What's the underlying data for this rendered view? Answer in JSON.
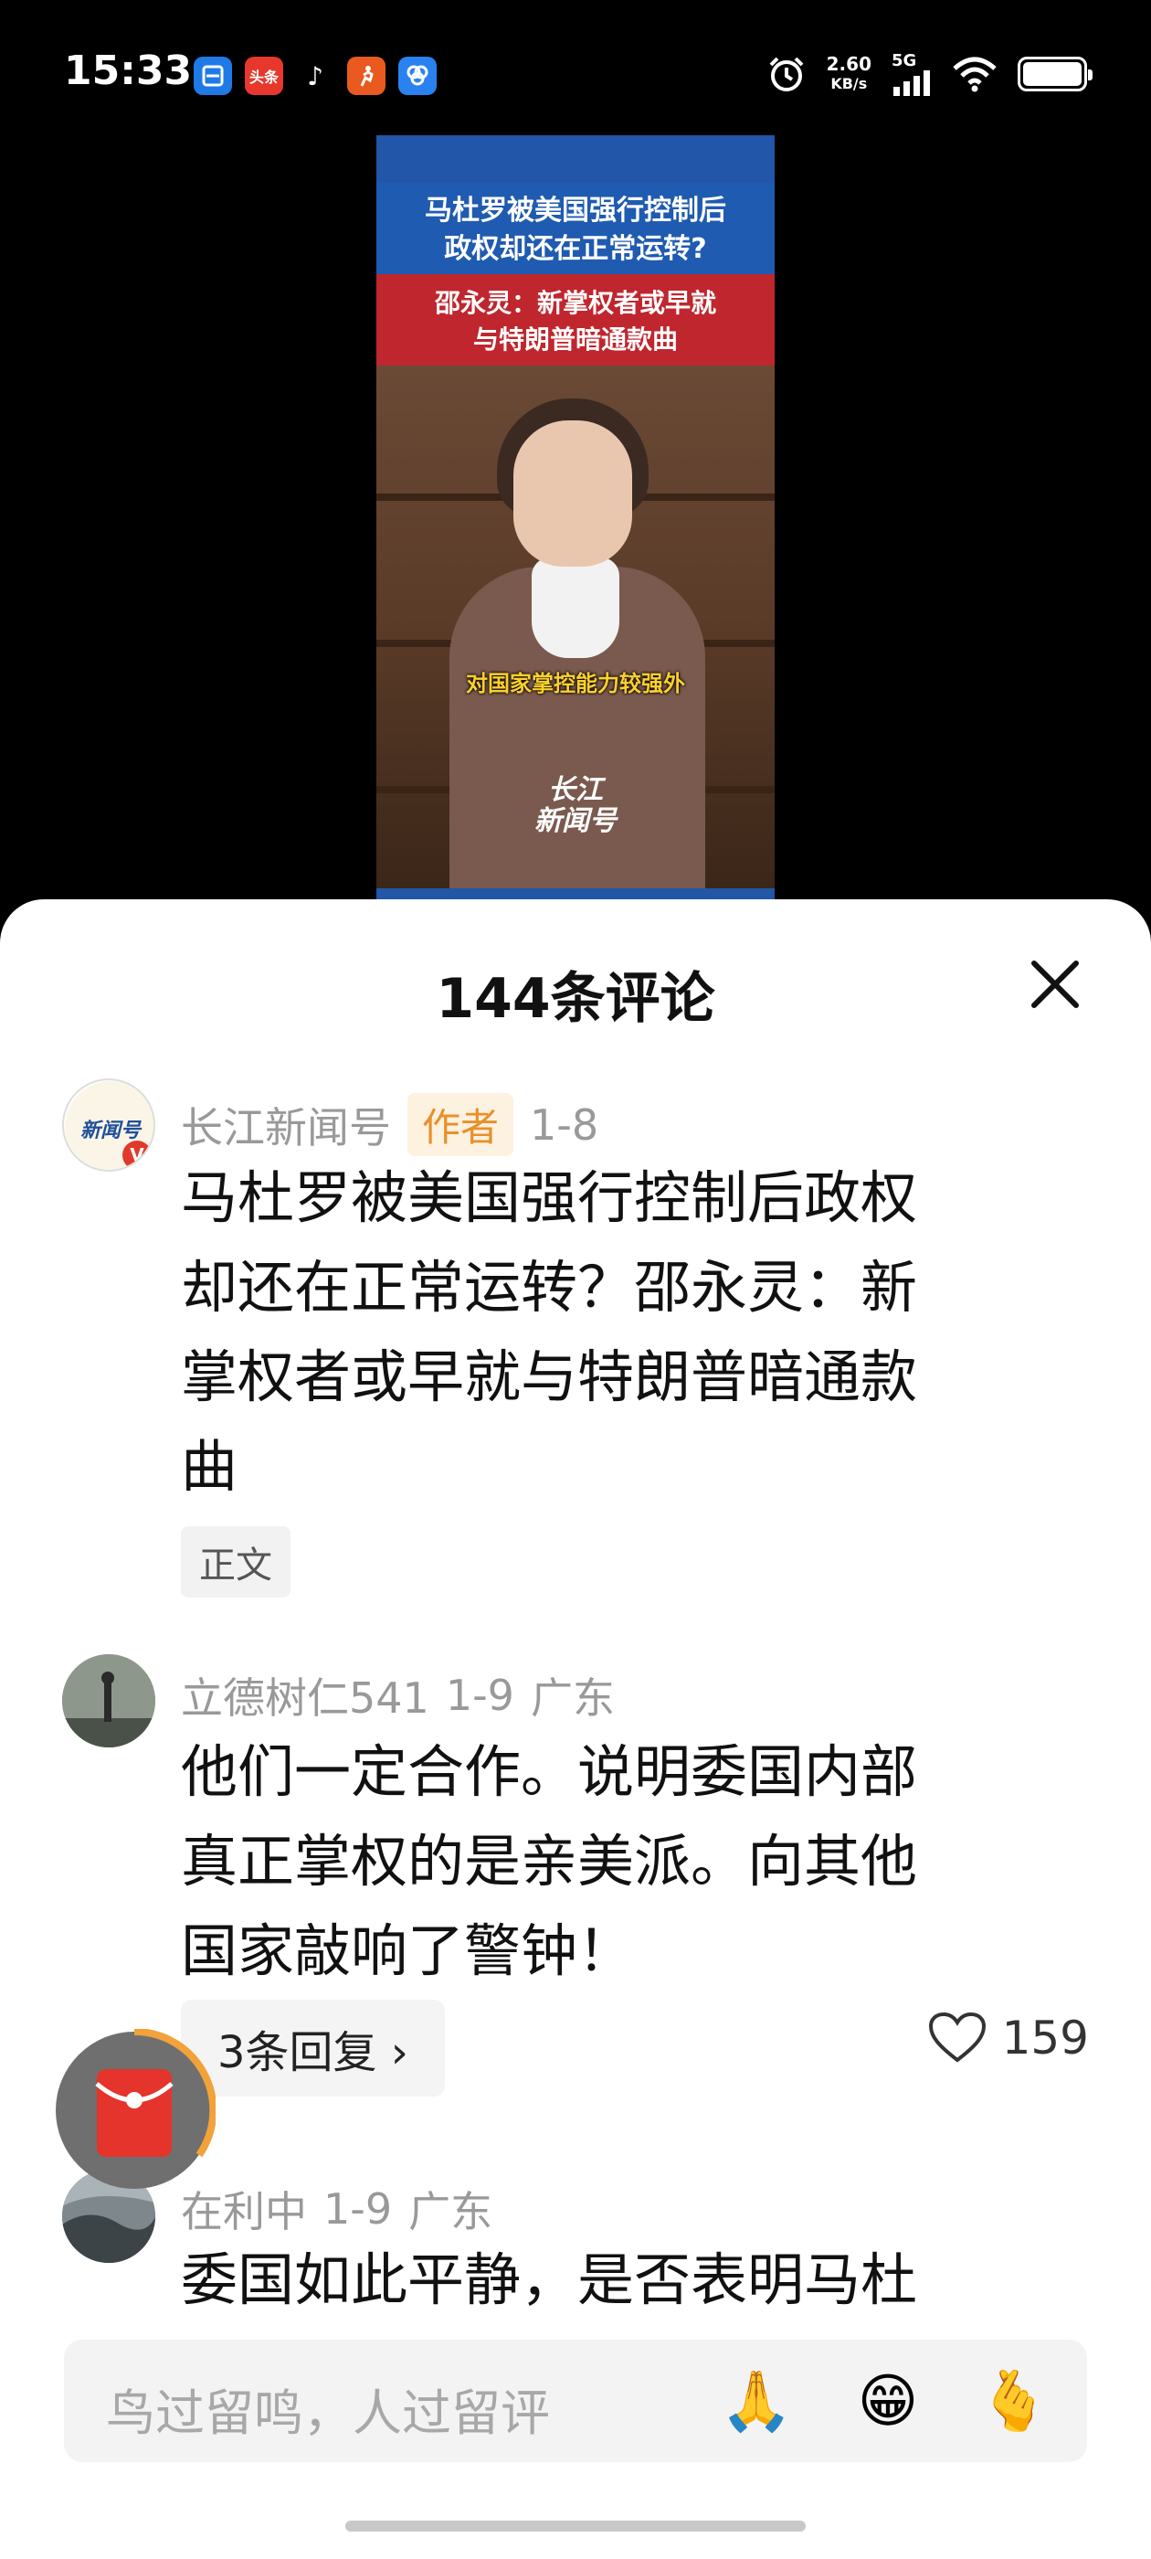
{
  "status_bar": {
    "time": "15:33",
    "app_icons": [
      {
        "name": "scan-app-icon",
        "label": "",
        "color": "#1f7ae8"
      },
      {
        "name": "toutiao-app-icon",
        "label": "头条",
        "color": "#e8372c"
      },
      {
        "name": "tiktok-app-icon",
        "label": "♪",
        "color": "#000000"
      },
      {
        "name": "runner-app-icon",
        "label": "",
        "color": "#e85a1f"
      },
      {
        "name": "cloud-app-icon",
        "label": "",
        "color": "#2a82f0"
      }
    ],
    "net_speed_value": "2.60",
    "net_speed_unit": "KB/s",
    "network_gen": "5G"
  },
  "video": {
    "title_line1": "马杜罗被美国强行控制后",
    "title_line2": "政权却还在正常运转?",
    "subtitle_line1": "邵永灵：新掌权者或早就",
    "subtitle_line2": "与特朗普暗通款曲",
    "caption": "对国家掌控能力较强外",
    "logo_line1": "长江",
    "logo_line2": "新闻号"
  },
  "comments_sheet": {
    "title": "144条评论",
    "comments": [
      {
        "author": "长江新闻号",
        "badge": "作者",
        "date": "1-8",
        "text_lines": [
          "马杜罗被美国强行控制后政权",
          "却还在正常运转？邵永灵：新",
          "掌权者或早就与特朗普暗通款",
          "曲"
        ],
        "tag": "正文"
      },
      {
        "author": "立德树仁541",
        "date": "1-9",
        "location": "广东",
        "text_lines": [
          "他们一定合作。说明委国内部",
          "真正掌权的是亲美派。向其他",
          "国家敲响了警钟！"
        ],
        "reply_label": "3条回复 ›",
        "likes": "159"
      },
      {
        "author": "在利中",
        "date": "1-9",
        "location": "广东",
        "text_lines": [
          "委国如此平静，是否表明马杜"
        ]
      }
    ]
  },
  "input_bar": {
    "placeholder": "鸟过留鸣，人过留评",
    "emojis": [
      "🙏",
      "😁",
      "🫰"
    ]
  }
}
